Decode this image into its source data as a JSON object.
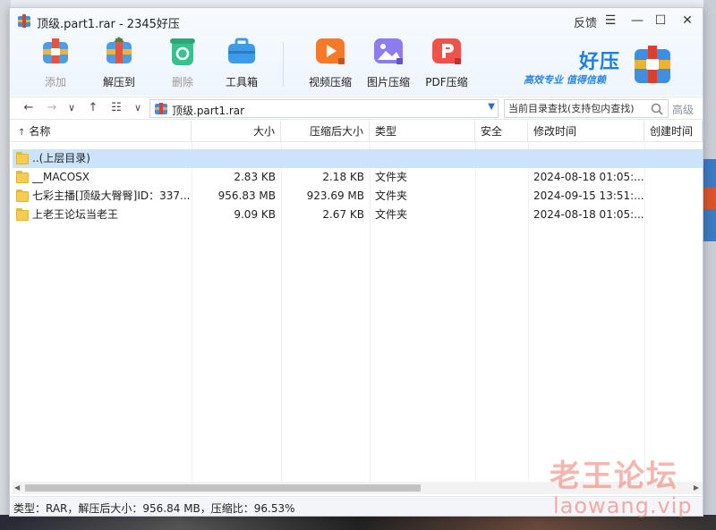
{
  "window": {
    "title": "顶级.part1.rar - 2345好压",
    "feedback_label": "反馈",
    "menu_glyph": "☰",
    "minimize_glyph": "—",
    "maximize_glyph": "☐",
    "close_glyph": "✕"
  },
  "toolbar": {
    "items": [
      {
        "label": "添加",
        "enabled": false,
        "icon": "add-archive-icon"
      },
      {
        "label": "解压到",
        "enabled": true,
        "icon": "extract-icon"
      },
      {
        "label": "删除",
        "enabled": false,
        "icon": "recycle-delete-icon"
      },
      {
        "label": "工具箱",
        "enabled": true,
        "icon": "toolbox-icon"
      },
      {
        "label": "视频压缩",
        "enabled": true,
        "icon": "video-compress-icon"
      },
      {
        "label": "图片压缩",
        "enabled": true,
        "icon": "image-compress-icon"
      },
      {
        "label": "PDF压缩",
        "enabled": true,
        "icon": "pdf-compress-icon"
      }
    ]
  },
  "brand": {
    "name": "好压",
    "slogan": "高效专业 值得信赖"
  },
  "address": {
    "path": "顶级.part1.rar",
    "search_placeholder": "当前目录查找(支持包内查找)",
    "advanced_label": "高级"
  },
  "columns": {
    "name": "名称",
    "size": "大小",
    "packed": "压缩后大小",
    "type": "类型",
    "security": "安全",
    "modified": "修改时间",
    "created": "创建时间"
  },
  "files": [
    {
      "name": "..(上层目录)",
      "size": "",
      "packed": "",
      "type": "",
      "security": "",
      "modified": "",
      "created": ""
    },
    {
      "name": "__MACOSX",
      "size": "2.83 KB",
      "packed": "2.18 KB",
      "type": "文件夹",
      "security": "",
      "modified": "2024-08-18 01:05:...",
      "created": ""
    },
    {
      "name": "七彩主播[顶级大臀臀]ID：337...",
      "size": "956.83 MB",
      "packed": "923.69 MB",
      "type": "文件夹",
      "security": "",
      "modified": "2024-09-15 13:51:...",
      "created": ""
    },
    {
      "name": "上老王论坛当老王",
      "size": "9.09 KB",
      "packed": "2.67 KB",
      "type": "文件夹",
      "security": "",
      "modified": "2024-08-18 01:05:...",
      "created": ""
    }
  ],
  "status": {
    "text": "类型：RAR，解压后大小：956.84 MB，压缩比：96.53%"
  },
  "watermark": {
    "line1": "老王论坛",
    "line2": "laowang.vip"
  },
  "colors": {
    "accent": "#1d7fe0",
    "selected_row": "#cce4fb",
    "folder": "#f6cd52"
  }
}
